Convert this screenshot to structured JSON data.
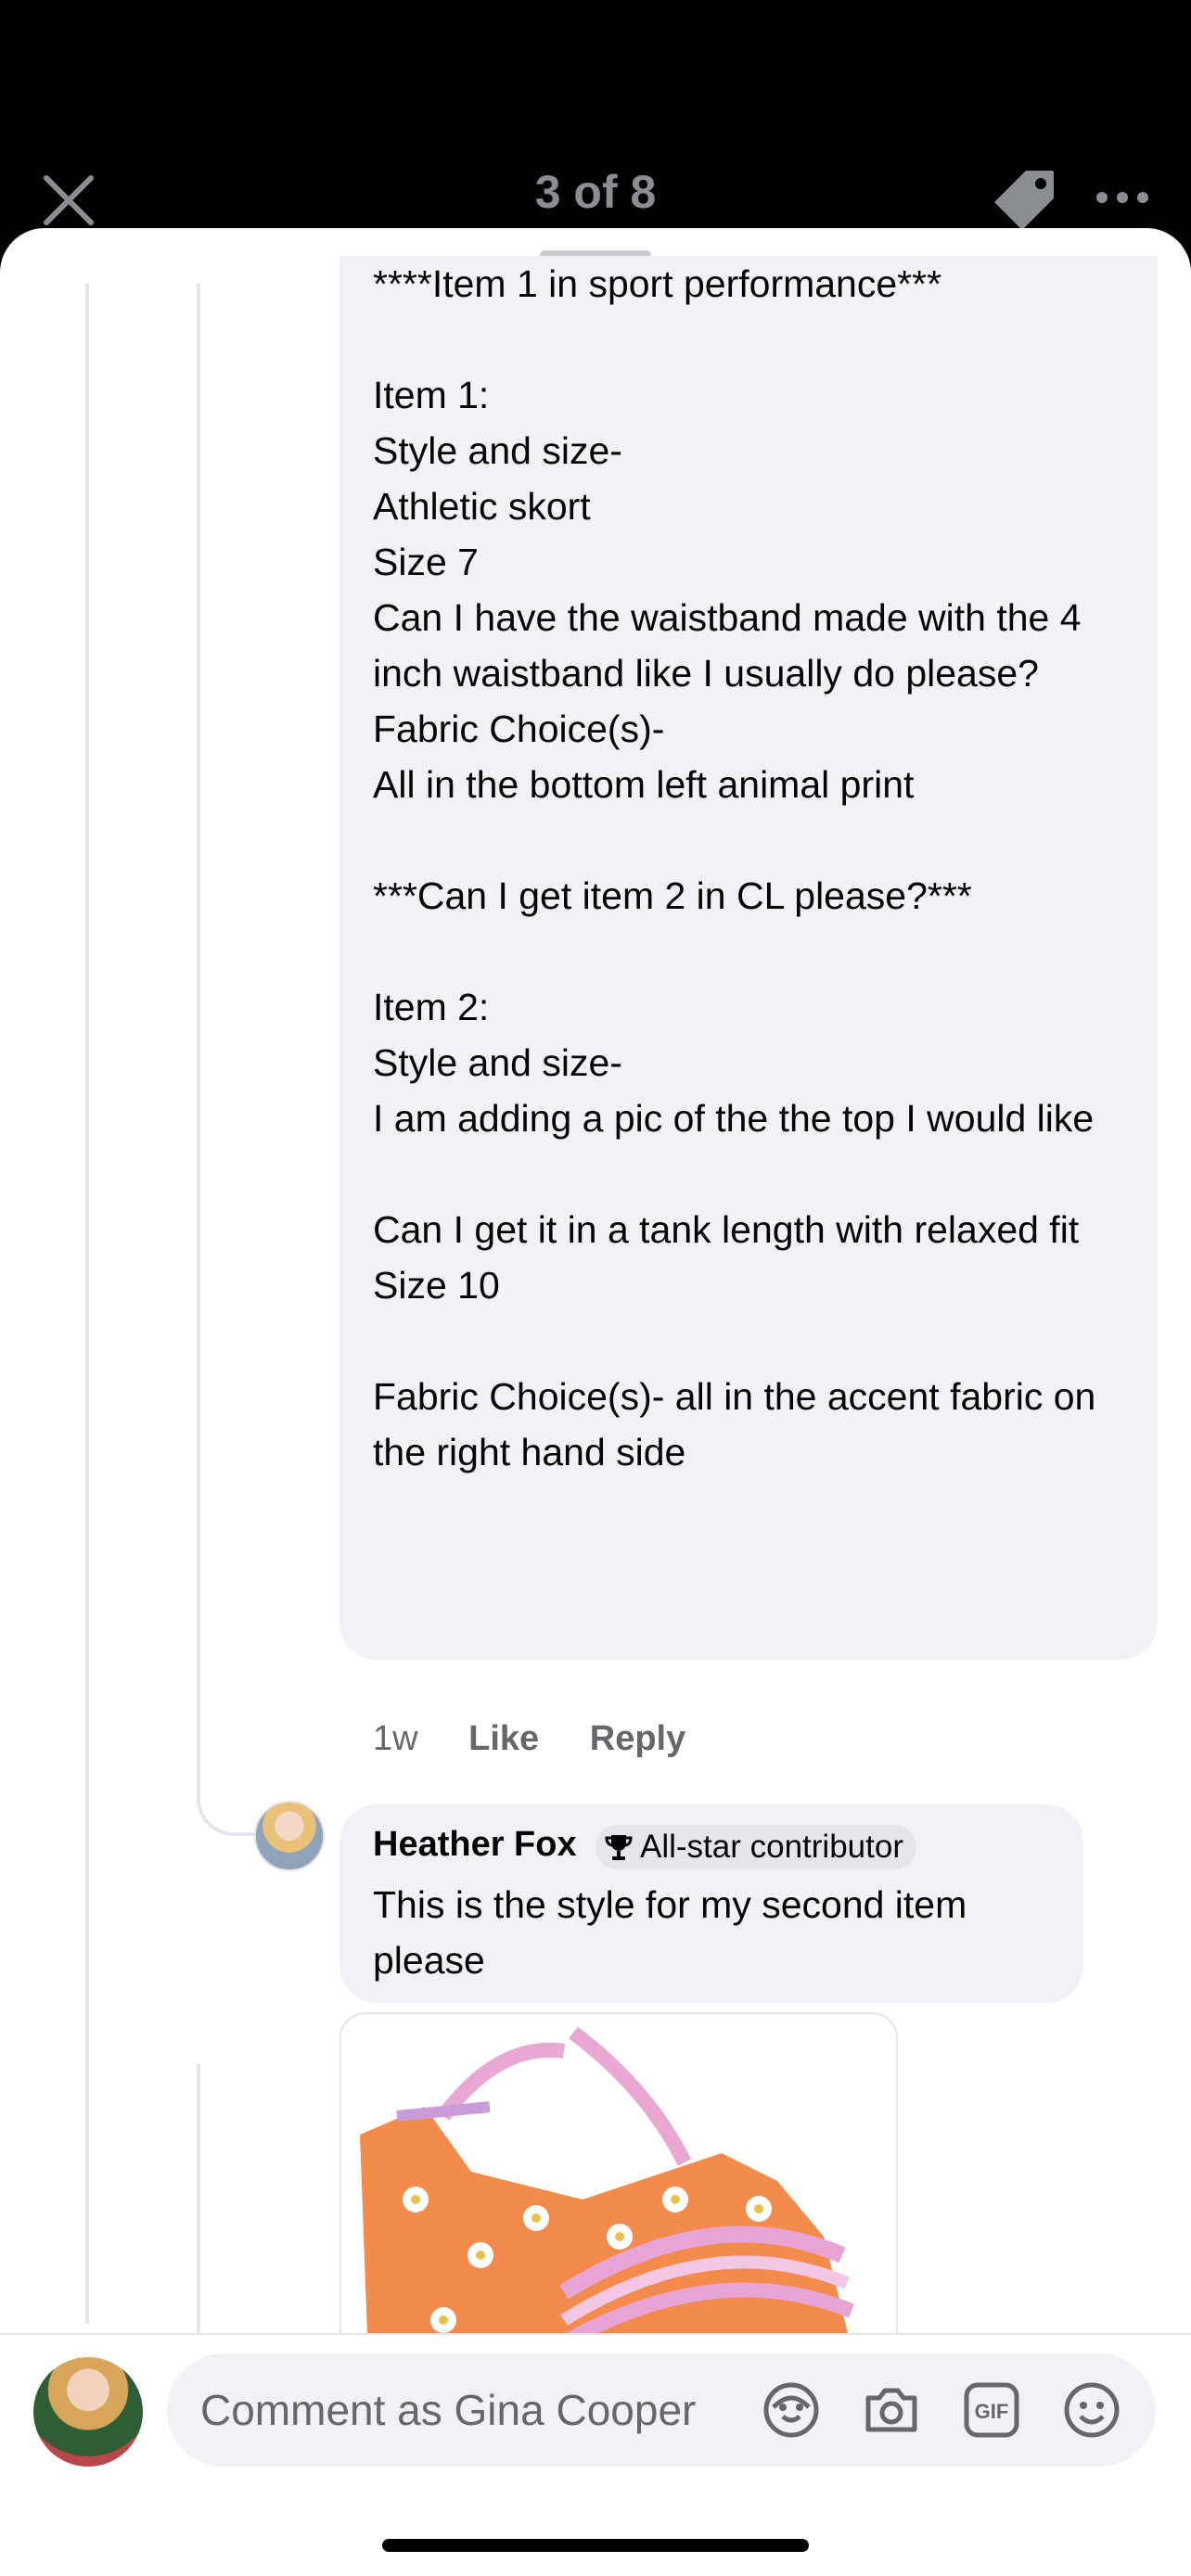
{
  "header": {
    "title": "3 of 8",
    "close_icon": "close-icon",
    "tag_icon": "tag-icon",
    "more_icon": "more-icon"
  },
  "comment1": {
    "text": "****Item 1 in sport performance***\n\nItem 1:\nStyle and size-\nAthletic skort\nSize 7\nCan I have the waistband made with the 4 inch waistband like I usually do please?\nFabric Choice(s)-\nAll in the bottom left animal print\n\n***Can I get item 2 in CL please?***\n\nItem 2:\nStyle and size-\nI am adding a pic of the the top I would like\n\nCan I get it in a tank length with relaxed fit\nSize 10\n\nFabric Choice(s)- all in the accent fabric on the right hand side",
    "time": "1w",
    "like_label": "Like",
    "reply_label": "Reply"
  },
  "comment2": {
    "author": "Heather Fox",
    "badge": "All-star contributor",
    "text": "This is the style for my second item please",
    "image": "orange-floral-tank-top-photo"
  },
  "composer": {
    "placeholder": "Comment as Gina Cooper",
    "icons": [
      "avatar-sticker-icon",
      "camera-icon",
      "gif-icon",
      "emoji-icon"
    ]
  },
  "colors": {
    "bubble": "#f0f2f5",
    "secondary_text": "#65676b",
    "header_text": "#8a8d91"
  }
}
